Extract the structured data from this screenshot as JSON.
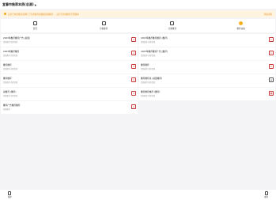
{
  "header": {
    "title": "宜春市推荐本质(总源)",
    "caret": "▲"
  },
  "notice": {
    "text": "后台已启用推荐(简称) 已为您推荐总数据资源推荐 ... 后台已启用推荐引擎版本",
    "link": "查看详情"
  },
  "tabs": [
    {
      "label": "首页",
      "icon": "home-icon"
    },
    {
      "label": "分类推荐",
      "icon": "calendar-icon"
    },
    {
      "label": "分类推荐",
      "icon": "image-icon"
    },
    {
      "label": "推荐动态",
      "icon": "star-icon"
    }
  ],
  "cards": [
    {
      "title": "2023年推荐推荐广告 (总量)",
      "sub": "资源推荐 推荐资源",
      "btn": "×"
    },
    {
      "title": "2023年推荐推荐推荐 (推荐)",
      "sub": "资源推荐 推荐资源",
      "btn": "×"
    },
    {
      "title": "2023年推荐推荐",
      "sub": "资源推荐 推荐资源",
      "btn": "×"
    },
    {
      "title": "2023年推荐推荐广告 (推荐)",
      "sub": "资源推荐 推荐资源",
      "btn": "×"
    },
    {
      "title": "推荐推荐",
      "sub": "资源推荐 推荐资源",
      "btn": "×"
    },
    {
      "title": "推荐推荐",
      "sub": "资源推荐 推荐资源",
      "btn": "×"
    },
    {
      "title": "推荐推荐",
      "sub": "资源推荐 推荐资源",
      "btn": "×"
    },
    {
      "title": "推荐推荐总 (总量推荐)",
      "sub": "资源推荐 推荐资源",
      "btn": "≡"
    },
    {
      "title": "总推荐 (推荐)",
      "sub": "资源推荐 推荐资源",
      "btn": "×"
    },
    {
      "title": "推荐推荐推荐 (推荐)",
      "sub": "资源推荐 推荐资源",
      "btn": "▦"
    },
    {
      "title": "推荐广告推荐推荐",
      "sub": "资源推荐",
      "btn": "×"
    }
  ],
  "bottom": {
    "left_label": "推荐",
    "right_label": "推荐"
  }
}
